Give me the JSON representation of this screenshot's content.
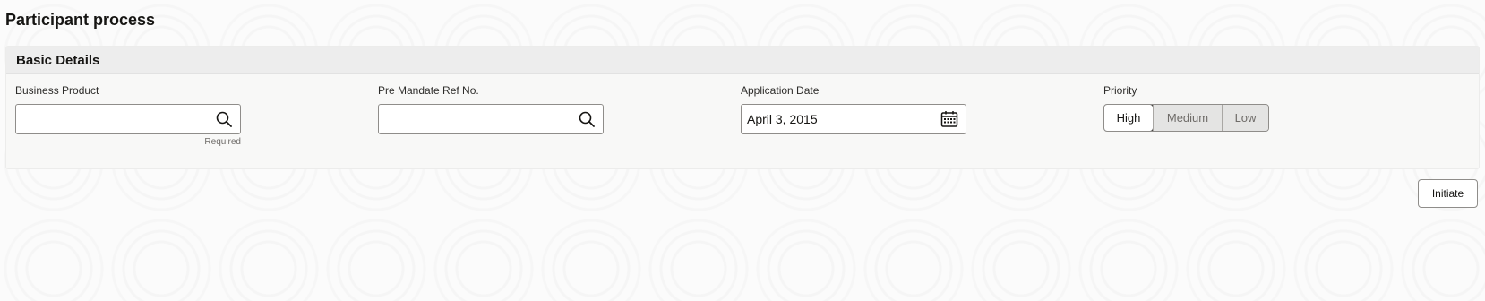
{
  "page": {
    "title": "Participant process"
  },
  "section": {
    "title": "Basic Details",
    "fields": {
      "business_product": {
        "label": "Business Product",
        "value": "",
        "hint": "Required",
        "icon": "search-icon"
      },
      "pre_mandate_ref": {
        "label": "Pre Mandate Ref No.",
        "value": "",
        "icon": "search-icon"
      },
      "application_date": {
        "label": "Application Date",
        "value": "April 3, 2015",
        "icon": "calendar-icon"
      },
      "priority": {
        "label": "Priority",
        "options": [
          "High",
          "Medium",
          "Low"
        ],
        "selected": "High"
      }
    }
  },
  "actions": {
    "initiate_label": "Initiate"
  }
}
